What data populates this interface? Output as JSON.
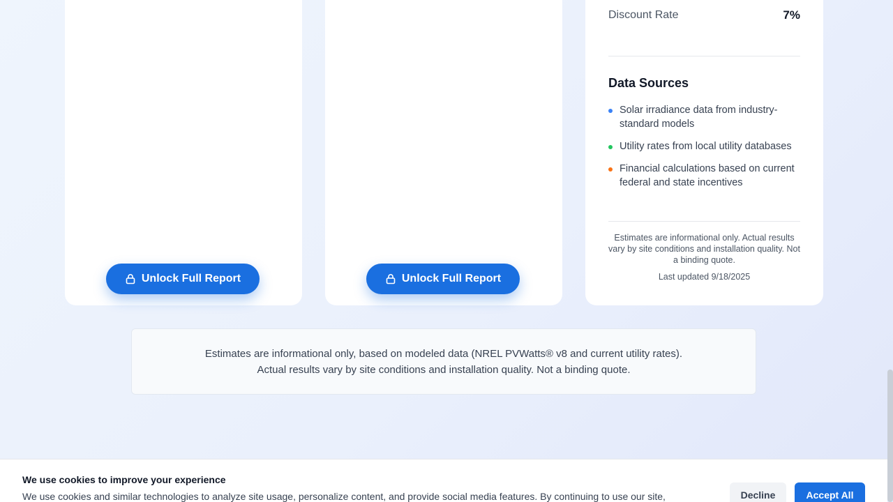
{
  "cards": {
    "unlock_label": "Unlock Full Report",
    "lock_icon": "lock-icon"
  },
  "assumptions": {
    "discount_rate_label": "Discount Rate",
    "discount_rate_value": "7%"
  },
  "data_sources": {
    "title": "Data Sources",
    "items": [
      {
        "text": "Solar irradiance data from industry-standard models",
        "color": "#3b82f6"
      },
      {
        "text": "Utility rates from local utility databases",
        "color": "#22c55e"
      },
      {
        "text": "Financial calculations based on current federal and state incentives",
        "color": "#f97316"
      }
    ],
    "note": "Estimates are informational only. Actual results vary by site conditions and installation quality. Not a binding quote.",
    "last_updated": "Last updated 9/18/2025"
  },
  "disclaimer": {
    "line1": "Estimates are informational only, based on modeled data (NREL PVWatts® v8 and current utility rates).",
    "line2": "Actual results vary by site conditions and installation quality. Not a binding quote."
  },
  "cookie_banner": {
    "title": "We use cookies to improve your experience",
    "text": "We use cookies and similar technologies to analyze site usage, personalize content, and provide social media features. By continuing to use our site,",
    "decline_label": "Decline",
    "accept_label": "Accept All"
  },
  "colors": {
    "accent": "#1a6fe0"
  }
}
